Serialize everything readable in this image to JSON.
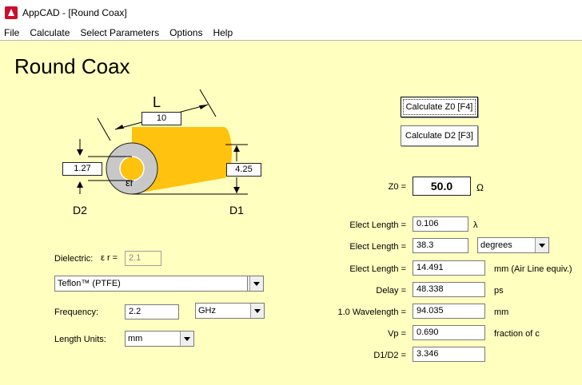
{
  "window": {
    "title": "AppCAD - [Round Coax]"
  },
  "menu": [
    "File",
    "Calculate",
    "Select Parameters",
    "Options",
    "Help"
  ],
  "page_title": "Round Coax",
  "diagram": {
    "L_label": "L",
    "L_value": "10",
    "D2_value": "1.27",
    "D1_value": "4.25",
    "D2_label": "D2",
    "D1_label": "D1",
    "er_symbol": "εr",
    "conductor_color": "#ffc20e"
  },
  "buttons": {
    "calc_z0": "Calculate Z0  [F4]",
    "calc_d2": "Calculate D2  [F3]"
  },
  "dielectric": {
    "label": "Dielectric:",
    "er_label": "ε r =",
    "er_value": "2.1",
    "material": "Teflon™  (PTFE)"
  },
  "frequency": {
    "label": "Frequency:",
    "value": "2.2",
    "unit": "GHz"
  },
  "length_units": {
    "label": "Length Units:",
    "value": "mm"
  },
  "results": {
    "z0_label": "Z0 =",
    "z0_value": "50.0",
    "z0_unit": "Ω",
    "elect_length_label": "Elect Length =",
    "elect_length_lambda": "0.106",
    "lambda_unit": "λ",
    "elect_length_deg": "38.3",
    "deg_unit": "degrees",
    "elect_length_mm": "14.491",
    "mm_air_unit": "mm  (Air Line equiv.)",
    "delay_label": "Delay =",
    "delay_value": "48.338",
    "delay_unit": "ps",
    "wavelength_label": "1.0 Wavelength =",
    "wavelength_value": "94.035",
    "wavelength_unit": "mm",
    "vp_label": "Vp =",
    "vp_value": "0.690",
    "vp_unit": "fraction of c",
    "d1d2_label": "D1/D2 =",
    "d1d2_value": "3.346"
  }
}
